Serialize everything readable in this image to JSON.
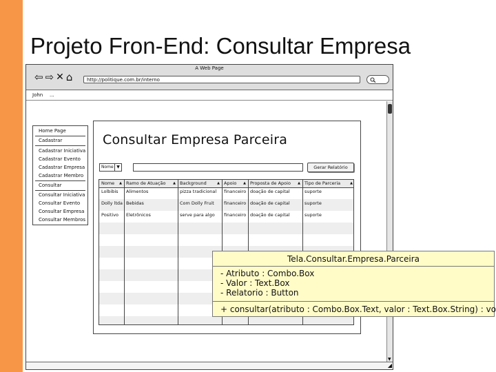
{
  "slide": {
    "title": "Projeto Fron-End: Consultar Empresa"
  },
  "browser": {
    "window_title": "A Web Page",
    "url": "http://politique.com.br/interno",
    "bookmarks": [
      "John",
      "..."
    ]
  },
  "side_menu": {
    "items": [
      "Home Page",
      "Cadastrar",
      "Cadastrar Iniciativa",
      "Cadastrar Evento",
      "Cadastrar Empresa",
      "Cadastrar Membro",
      "Consultar",
      "Consultar Iniciativa",
      "Consultar Evento",
      "Consultar Empresa",
      "Consultar Membros"
    ]
  },
  "page": {
    "heading": "Consultar Empresa Parceira",
    "filter_combo_value": "Nome",
    "report_button": "Gerar Relatório"
  },
  "grid": {
    "columns": [
      "Nome",
      "Ramo de Atuação",
      "Background",
      "Apoio",
      "Proposta de Apoio",
      "Tipo de Parceria"
    ],
    "rows": [
      [
        "Lolbibis",
        "Alimentos",
        "pizza tradicional",
        "financeiro",
        "doação de capital",
        "suporte"
      ],
      [
        "Dolly ltda",
        "Bebidas",
        "Com Dolly Fruit",
        "financeiro",
        "doação de capital",
        "suporte"
      ],
      [
        "Positivo",
        "Eletrônicos",
        "serve para algo",
        "financeiro",
        "doação de capital",
        "suporte"
      ]
    ]
  },
  "uml": {
    "class_name": "Tela.Consultar.Empresa.Parceira",
    "attributes": [
      "- Atributo : Combo.Box",
      "- Valor : Text.Box",
      "- Relatorio : Button"
    ],
    "operation": "+ consultar(atributo : Combo.Box.Text, valor : Text.Box.String) : void"
  },
  "colors": {
    "accent_bar": "#f79646",
    "uml_fill": "#fffcc8"
  }
}
